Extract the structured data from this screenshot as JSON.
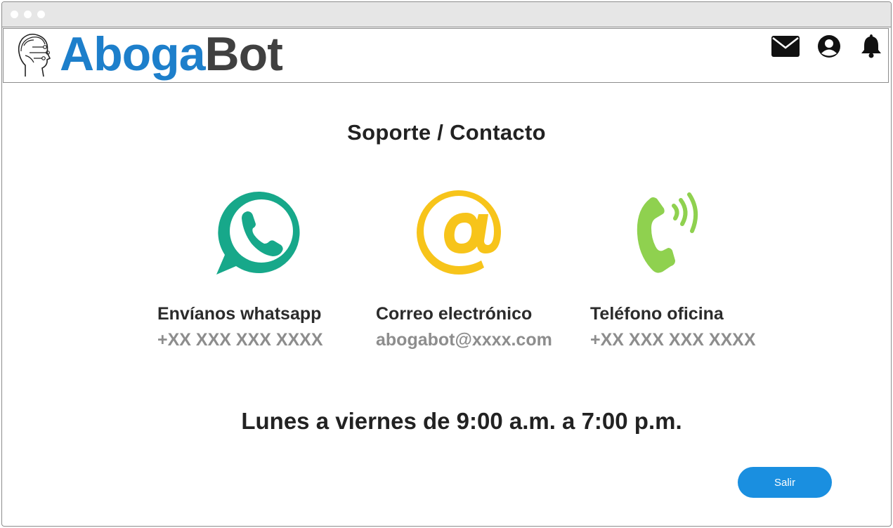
{
  "app": {
    "logo_part1": "Aboga",
    "logo_part2": "Bot"
  },
  "header_icons": [
    "mail-icon",
    "user-account-icon",
    "bell-icon"
  ],
  "page": {
    "title": "Soporte / Contacto"
  },
  "contacts": [
    {
      "icon": "whatsapp-icon",
      "label": "Envíanos whatsapp",
      "value": "+XX XXX XXX XXXX",
      "color": "#17a88a"
    },
    {
      "icon": "at-sign-icon",
      "label": "Correo electrónico",
      "value": "abogabot@xxxx.com",
      "color": "#f7c41a"
    },
    {
      "icon": "phone-icon",
      "label": "Teléfono oficina",
      "value": "+XX XXX XXX XXXX",
      "color": "#8fd14f"
    }
  ],
  "hours": "Lunes a viernes de 9:00 a.m. a 7:00 p.m.",
  "exit_button": "Salir",
  "colors": {
    "brand_blue": "#1d7fcb",
    "brand_dark": "#404040",
    "button": "#1a8fe0"
  }
}
